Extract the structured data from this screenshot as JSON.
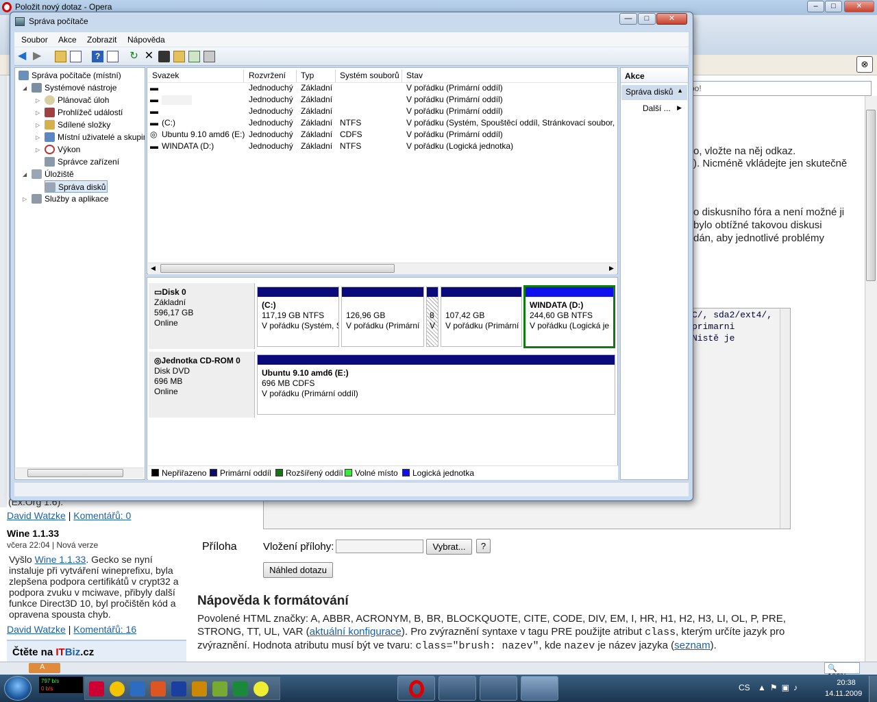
{
  "opera": {
    "title": "Položit nový dotaz - Opera",
    "address_text": "oo!",
    "page_text_1": "o, vložte na něj odkaz.",
    "page_text_2": "). Nicméně vkládejte jen skutečně",
    "page_text_3": "o diskusního fóra a není možné ji",
    "page_text_4": "bylo obtížné takovou diskusi",
    "page_text_5": "dán, aby jednotlivé problémy",
    "code_snippet": "C/, sda2/ext4/,\nprimarni\nNistě je",
    "xorg_text": "(Ex.Org 1.6).",
    "author_1": "David Watzke",
    "comments_1": "Komentářů: 0",
    "news_title": "Wine 1.1.33",
    "news_date": "včera 22:04",
    "news_category": "Nová verze",
    "news_intro": "Vyšlo ",
    "news_link": "Wine 1.1.33",
    "news_body": ". Gecko se nyní instaluje při vytváření wineprefixu, byla zlepšena podpora certifikátů v crypt32 a podpora zvuku v mciwave, přibyly další funkce Direct3D 10, byl pročištěn kód a opravena spousta chyb.",
    "author_2": "David Watzke",
    "comments_2": "Komentářů: 16",
    "itbiz_prefix": "Čtěte na ",
    "itbiz_it": "IT",
    "itbiz_biz": "Biz",
    "itbiz_suffix": ".cz",
    "attachment_label": "Příloha",
    "attachment_insert": "Vložení přílohy:",
    "choose_button": "Vybrat...",
    "help_button": "?",
    "preview_button": "Náhled dotazu",
    "help_heading": "Nápověda k formátování",
    "help_p1": "Povolené HTML značky: A, ABBR, ACRONYM, B, BR, BLOCKQUOTE, CITE, CODE, DIV, EM, I, HR, H1, H2, H3, LI, OL, P, PRE, STRONG, TT, UL, VAR (",
    "help_link1": "aktuální konfigurace",
    "help_p2": "). Pro zvýraznění syntaxe v tagu PRE použijte atribut ",
    "help_code1": "class",
    "help_p3": ", kterým určíte jazyk pro zvýraznění. Hodnota atributu musí být ve tvaru: ",
    "help_code2": "class=\"brush: nazev\"",
    "help_p4": ", kde ",
    "help_code3": "nazev",
    "help_p5": " je název jazyka (",
    "help_link2": "seznam",
    "help_p6": ").",
    "zoom": "100%",
    "status_a": "A"
  },
  "window": {
    "title": "Správa počítače",
    "minimize": "—",
    "maximize": "□",
    "close": "✕"
  },
  "menu": [
    "Soubor",
    "Akce",
    "Zobrazit",
    "Nápověda"
  ],
  "tree": [
    {
      "label": "Správa počítače (místní)",
      "icon": "computer-icon"
    },
    {
      "label": "Systémové nástroje",
      "icon": "tools-icon"
    },
    {
      "label": "Plánovač úloh",
      "icon": "clock-icon"
    },
    {
      "label": "Prohlížeč událostí",
      "icon": "event-viewer-icon"
    },
    {
      "label": "Sdílené složky",
      "icon": "shared-folder-icon"
    },
    {
      "label": "Místní uživatelé a skupiny",
      "icon": "users-icon"
    },
    {
      "label": "Výkon",
      "icon": "performance-icon"
    },
    {
      "label": "Správce zařízení",
      "icon": "device-manager-icon"
    },
    {
      "label": "Úložiště",
      "icon": "storage-icon"
    },
    {
      "label": "Správa disků",
      "icon": "disk-management-icon"
    },
    {
      "label": "Služby a aplikace",
      "icon": "services-icon"
    }
  ],
  "columns": [
    "Svazek",
    "Rozvržení",
    "Typ",
    "Systém souborů",
    "Stav"
  ],
  "volumes": [
    {
      "name": "",
      "layout": "Jednoduchý",
      "type": "Základní",
      "fs": "",
      "status": "V pořádku (Primární oddíl)"
    },
    {
      "name": "",
      "layout": "Jednoduchý",
      "type": "Základní",
      "fs": "",
      "status": "V pořádku (Primární oddíl)"
    },
    {
      "name": "",
      "layout": "Jednoduchý",
      "type": "Základní",
      "fs": "",
      "status": "V pořádku (Primární oddíl)"
    },
    {
      "name": "(C:)",
      "layout": "Jednoduchý",
      "type": "Základní",
      "fs": "NTFS",
      "status": "V pořádku (Systém, Spouštěcí oddíl, Stránkovací soubor, A"
    },
    {
      "name": "Ubuntu 9.10 amd6 (E:)",
      "layout": "Jednoduchý",
      "type": "Základní",
      "fs": "CDFS",
      "status": "V pořádku (Primární oddíl)"
    },
    {
      "name": "WINDATA (D:)",
      "layout": "Jednoduchý",
      "type": "Základní",
      "fs": "NTFS",
      "status": "V pořádku (Logická jednotka)"
    }
  ],
  "disk0": {
    "name": "Disk 0",
    "type": "Základní",
    "size": "596,17 GB",
    "state": "Online",
    "partitions": [
      {
        "title": "(C:)",
        "size": "117,19 GB NTFS",
        "status": "V pořádku (Systém, S"
      },
      {
        "title": "",
        "size": "126,96 GB",
        "status": "V pořádku (Primární"
      },
      {
        "title": "",
        "size": "8",
        "status": "V"
      },
      {
        "title": "",
        "size": "107,42 GB",
        "status": "V pořádku (Primární"
      },
      {
        "title": "WINDATA  (D:)",
        "size": "244,60 GB NTFS",
        "status": "V pořádku (Logická je"
      }
    ]
  },
  "cdrom": {
    "name": "Jednotka CD-ROM 0",
    "type": "Disk DVD",
    "size": "696 MB",
    "state": "Online",
    "partition": {
      "title": "Ubuntu 9.10 amd6  (E:)",
      "size": "696 MB CDFS",
      "status": "V pořádku (Primární oddíl)"
    }
  },
  "legend": [
    {
      "label": "Nepřiřazeno",
      "color": "#000000"
    },
    {
      "label": "Primární oddíl",
      "color": "#0a0a7a"
    },
    {
      "label": "Rozšířený oddíl",
      "color": "#0f7a0f"
    },
    {
      "label": "Volné místo",
      "color": "#33ee33"
    },
    {
      "label": "Logická jednotka",
      "color": "#1010ee"
    }
  ],
  "actions": {
    "header": "Akce",
    "section": "Správa disků",
    "more": "Další ..."
  },
  "taskbar": {
    "net_up": "797 b/s",
    "net_down": "0 b/s",
    "lang": "CS",
    "time": "20:38",
    "date": "14.11.2009"
  }
}
